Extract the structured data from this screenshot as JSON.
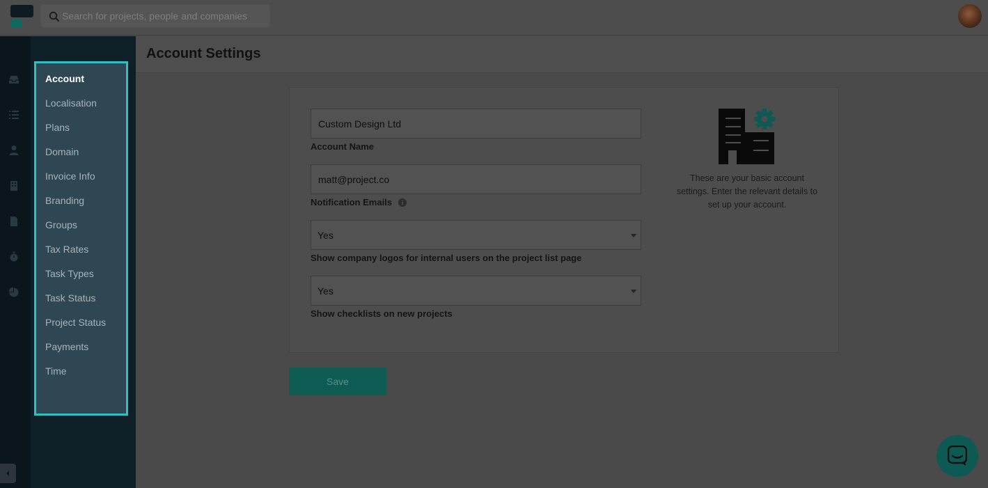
{
  "search": {
    "placeholder": "Search for projects, people and companies"
  },
  "settings_nav": {
    "items": [
      {
        "label": "Account",
        "active": true
      },
      {
        "label": "Localisation"
      },
      {
        "label": "Plans"
      },
      {
        "label": "Domain"
      },
      {
        "label": "Invoice Info"
      },
      {
        "label": "Branding"
      },
      {
        "label": "Groups"
      },
      {
        "label": "Tax Rates"
      },
      {
        "label": "Task Types"
      },
      {
        "label": "Task Status"
      },
      {
        "label": "Project Status"
      },
      {
        "label": "Payments"
      },
      {
        "label": "Time"
      }
    ]
  },
  "rail_icons": [
    "inbox-icon",
    "list-icon",
    "person-icon",
    "building-icon",
    "document-icon",
    "stopwatch-icon",
    "pie-chart-icon"
  ],
  "page": {
    "title": "Account Settings"
  },
  "form": {
    "account_name": {
      "value": "Custom Design Ltd",
      "label": "Account Name"
    },
    "notification_emails": {
      "value": "matt@project.co",
      "label": "Notification Emails"
    },
    "company_logos": {
      "value": "Yes",
      "label": "Show company logos for internal users on the project list page"
    },
    "checklists": {
      "value": "Yes",
      "label": "Show checklists on new projects"
    },
    "save_label": "Save"
  },
  "help": {
    "text": "These are your basic account settings. Enter the relevant details to set up your account."
  },
  "colors": {
    "accent": "#2fc0c6",
    "brand_teal": "#0d5b53",
    "nav_bg": "#0f1f27"
  }
}
